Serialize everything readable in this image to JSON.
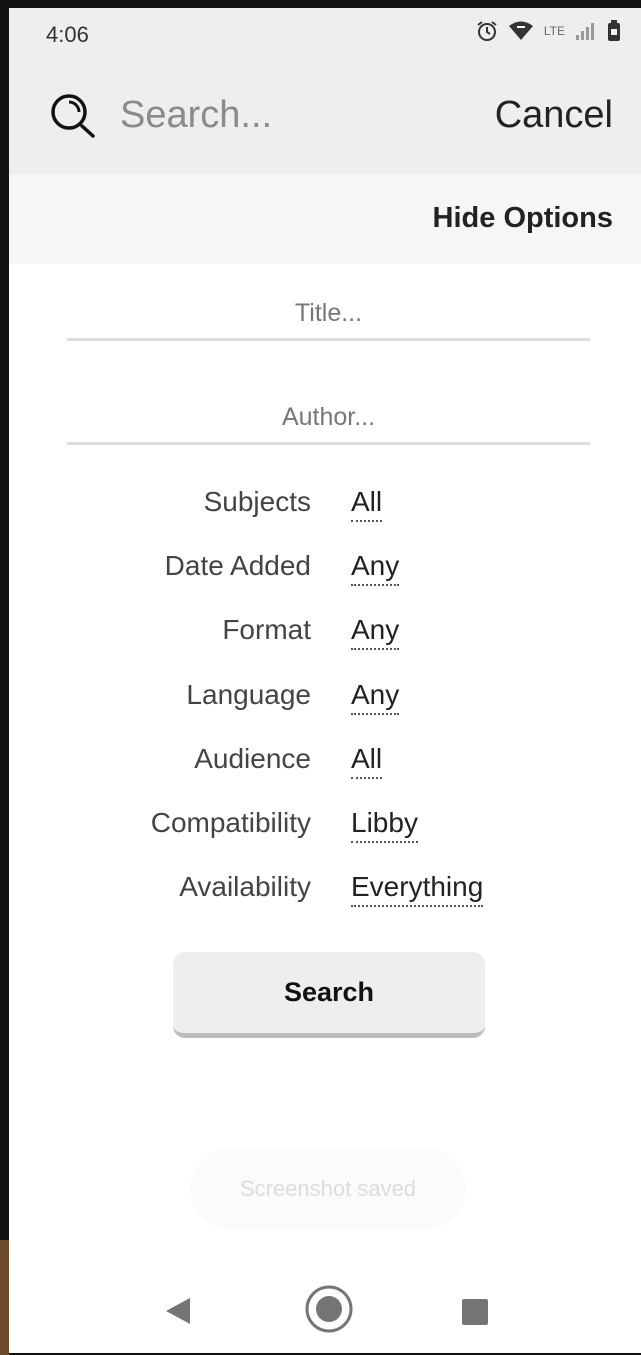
{
  "status_bar": {
    "time": "4:06",
    "network_label": "LTE"
  },
  "search_bar": {
    "placeholder": "Search...",
    "cancel_label": "Cancel"
  },
  "options": {
    "hide_label": "Hide Options"
  },
  "fields": {
    "title_placeholder": "Title...",
    "author_placeholder": "Author..."
  },
  "filters": [
    {
      "label": "Subjects",
      "value": "All"
    },
    {
      "label": "Date Added",
      "value": "Any"
    },
    {
      "label": "Format",
      "value": "Any"
    },
    {
      "label": "Language",
      "value": "Any"
    },
    {
      "label": "Audience",
      "value": "All"
    },
    {
      "label": "Compatibility",
      "value": "Libby"
    },
    {
      "label": "Availability",
      "value": "Everything"
    }
  ],
  "search_button_label": "Search",
  "toast": "Screenshot saved",
  "colors": {
    "header_bg": "#eeeeee",
    "options_bg": "#f6f6f6",
    "text_primary": "#222222",
    "text_muted": "#8a8a8a"
  },
  "icons": [
    "search-icon",
    "alarm-icon",
    "wifi-icon",
    "signal-icon",
    "battery-icon",
    "back-icon",
    "home-icon",
    "recents-icon"
  ]
}
